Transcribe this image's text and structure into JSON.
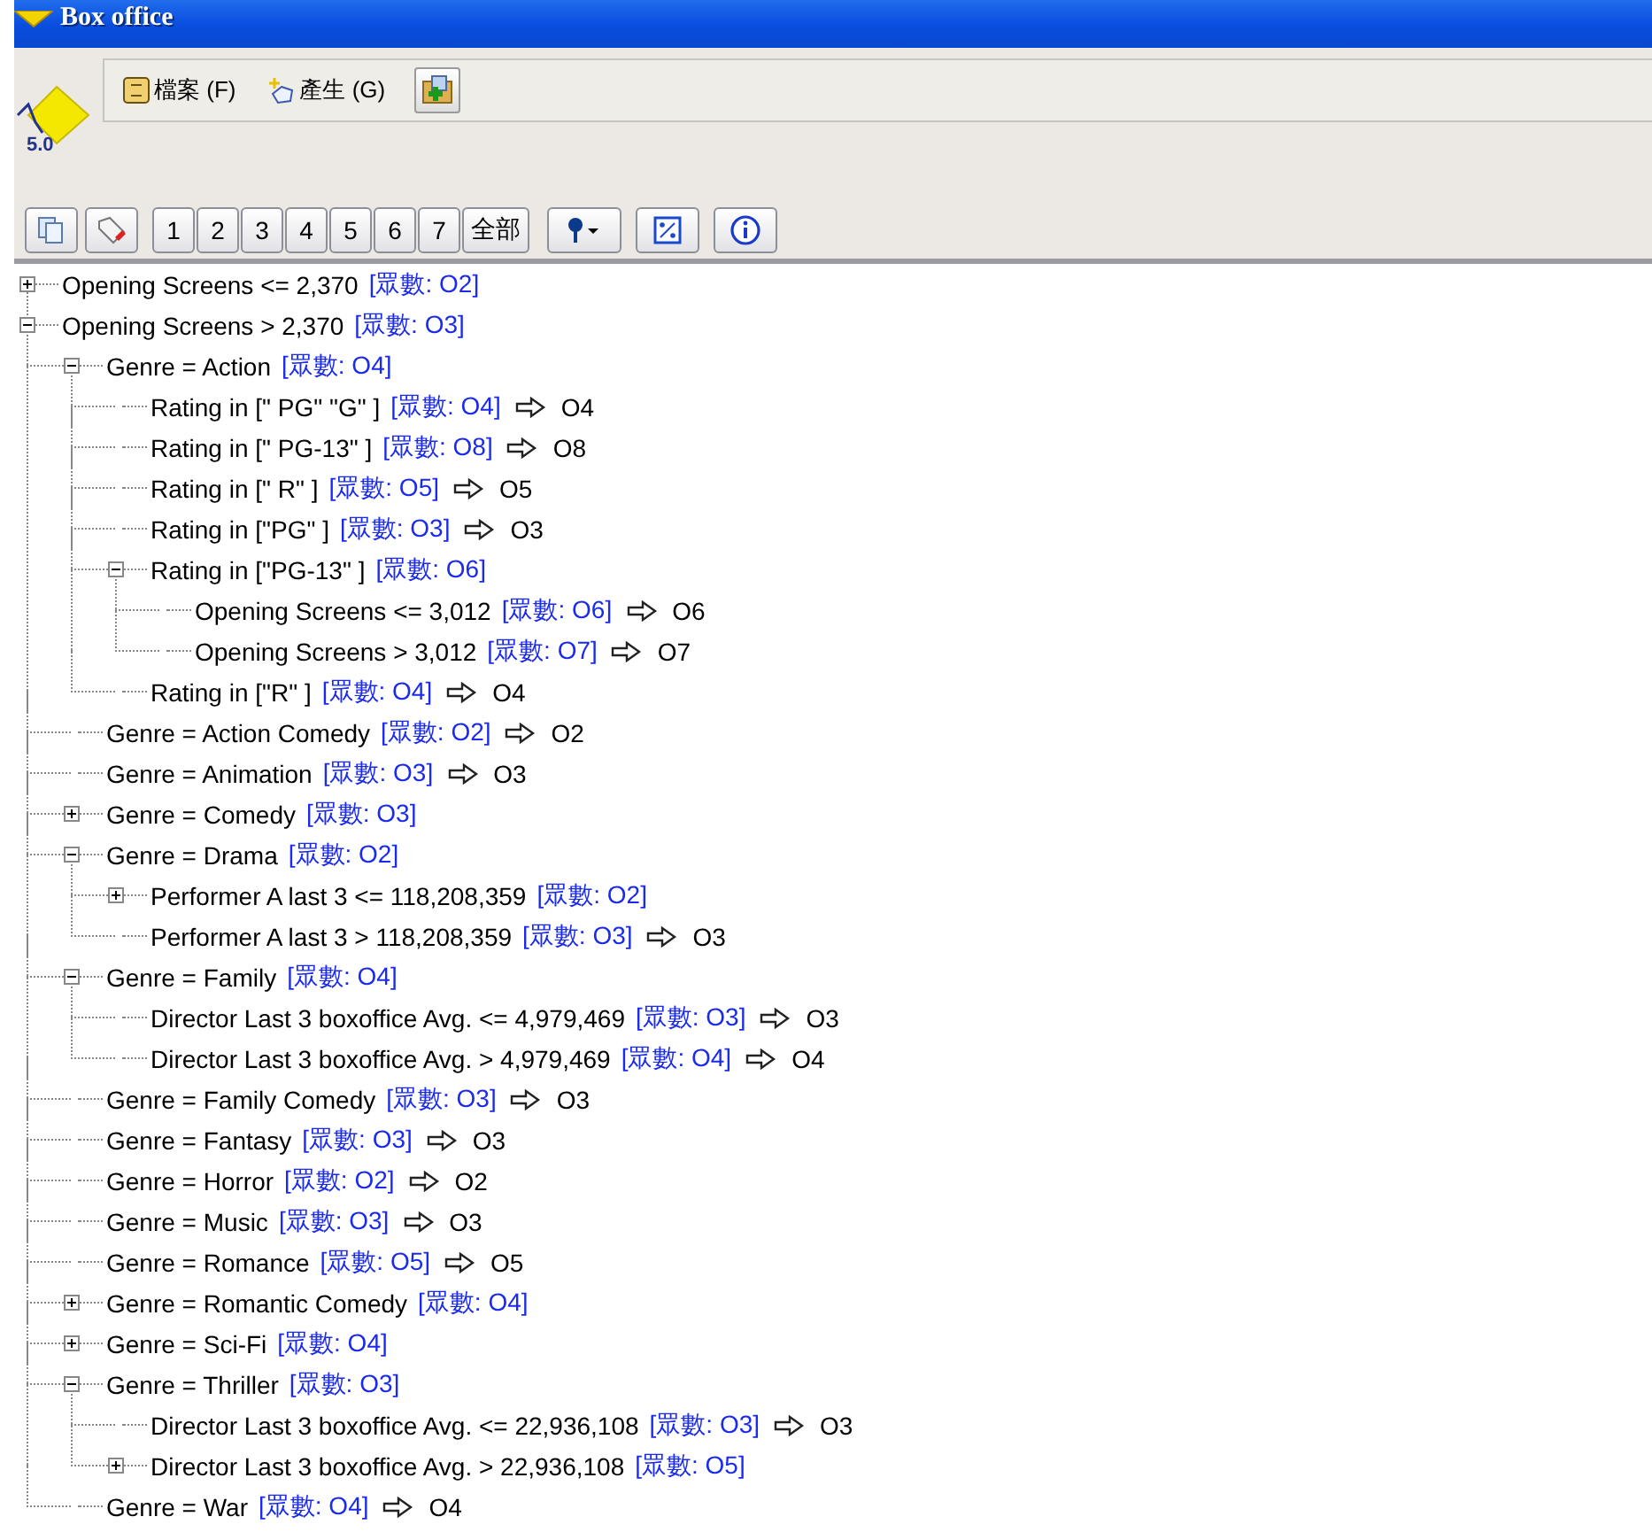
{
  "window": {
    "title": "Box office"
  },
  "logo": {
    "version": "5.0"
  },
  "menu": [
    {
      "label": "檔案 (F)"
    },
    {
      "label": "產生 (G)"
    }
  ],
  "toolbar": {
    "levels": [
      "1",
      "2",
      "3",
      "4",
      "5",
      "6",
      "7",
      "全部"
    ]
  },
  "tree": [
    {
      "kind": "branch",
      "expanded": false,
      "label": "Opening Screens <= 2,370",
      "count": "[眾數: O2]"
    },
    {
      "kind": "branch",
      "expanded": true,
      "label": "Opening Screens > 2,370",
      "count": "[眾數: O3]",
      "children": [
        {
          "kind": "branch",
          "expanded": true,
          "label": "Genre = Action",
          "count": "[眾數: O4]",
          "children": [
            {
              "kind": "leaf",
              "label": "Rating in [\" PG\" \"G\" ]",
              "count": "[眾數: O4]",
              "result": "O4"
            },
            {
              "kind": "leaf",
              "label": "Rating in [\" PG-13\" ]",
              "count": "[眾數: O8]",
              "result": "O8"
            },
            {
              "kind": "leaf",
              "label": "Rating in [\" R\" ]",
              "count": "[眾數: O5]",
              "result": "O5"
            },
            {
              "kind": "leaf",
              "label": "Rating in [\"PG\" ]",
              "count": "[眾數: O3]",
              "result": "O3"
            },
            {
              "kind": "branch",
              "expanded": true,
              "label": "Rating in [\"PG-13\" ]",
              "count": "[眾數: O6]",
              "children": [
                {
                  "kind": "leaf",
                  "label": "Opening Screens <= 3,012",
                  "count": "[眾數: O6]",
                  "result": "O6"
                },
                {
                  "kind": "leaf",
                  "label": "Opening Screens > 3,012",
                  "count": "[眾數: O7]",
                  "result": "O7"
                }
              ]
            },
            {
              "kind": "leaf",
              "label": "Rating in [\"R\" ]",
              "count": "[眾數: O4]",
              "result": "O4"
            }
          ]
        },
        {
          "kind": "leaf",
          "label": "Genre = Action Comedy",
          "count": "[眾數: O2]",
          "result": "O2"
        },
        {
          "kind": "leaf",
          "label": "Genre = Animation",
          "count": "[眾數: O3]",
          "result": "O3"
        },
        {
          "kind": "branch",
          "expanded": false,
          "label": "Genre = Comedy",
          "count": "[眾數: O3]"
        },
        {
          "kind": "branch",
          "expanded": true,
          "label": "Genre = Drama",
          "count": "[眾數: O2]",
          "children": [
            {
              "kind": "branch",
              "expanded": false,
              "label": "Performer A last 3 <= 118,208,359",
              "count": "[眾數: O2]"
            },
            {
              "kind": "leaf",
              "label": "Performer A last 3 > 118,208,359",
              "count": "[眾數: O3]",
              "result": "O3"
            }
          ]
        },
        {
          "kind": "branch",
          "expanded": true,
          "label": "Genre = Family",
          "count": "[眾數: O4]",
          "children": [
            {
              "kind": "leaf",
              "label": "Director Last 3 boxoffice Avg. <= 4,979,469",
              "count": "[眾數: O3]",
              "result": "O3"
            },
            {
              "kind": "leaf",
              "label": "Director Last 3 boxoffice Avg. > 4,979,469",
              "count": "[眾數: O4]",
              "result": "O4"
            }
          ]
        },
        {
          "kind": "leaf",
          "label": "Genre = Family Comedy",
          "count": "[眾數: O3]",
          "result": "O3"
        },
        {
          "kind": "leaf",
          "label": "Genre = Fantasy",
          "count": "[眾數: O3]",
          "result": "O3"
        },
        {
          "kind": "leaf",
          "label": "Genre = Horror",
          "count": "[眾數: O2]",
          "result": "O2"
        },
        {
          "kind": "leaf",
          "label": "Genre = Music",
          "count": "[眾數: O3]",
          "result": "O3"
        },
        {
          "kind": "leaf",
          "label": "Genre = Romance",
          "count": "[眾數: O5]",
          "result": "O5"
        },
        {
          "kind": "branch",
          "expanded": false,
          "label": "Genre = Romantic Comedy",
          "count": "[眾數: O4]"
        },
        {
          "kind": "branch",
          "expanded": false,
          "label": "Genre = Sci-Fi",
          "count": "[眾數: O4]"
        },
        {
          "kind": "branch",
          "expanded": true,
          "label": "Genre = Thriller",
          "count": "[眾數: O3]",
          "children": [
            {
              "kind": "leaf",
              "label": "Director Last 3 boxoffice Avg. <= 22,936,108",
              "count": "[眾數: O3]",
              "result": "O3"
            },
            {
              "kind": "branch",
              "expanded": false,
              "label": "Director Last 3 boxoffice Avg. > 22,936,108",
              "count": "[眾數: O5]"
            }
          ]
        },
        {
          "kind": "leaf",
          "label": "Genre = War",
          "count": "[眾數: O4]",
          "result": "O4"
        }
      ]
    }
  ]
}
